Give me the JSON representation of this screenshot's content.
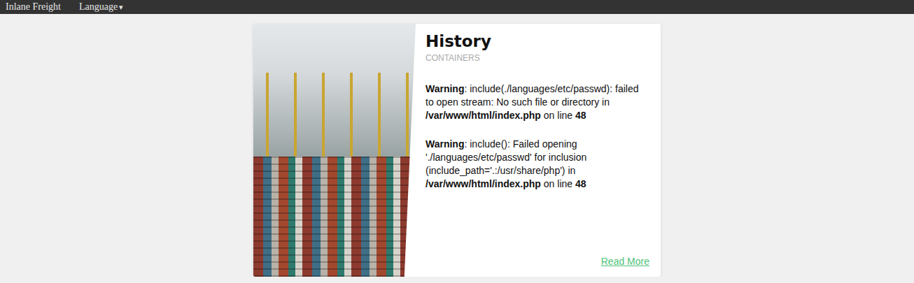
{
  "navbar": {
    "brand": "Inlane Freight",
    "menu": {
      "label": "Language",
      "caret": "▾"
    }
  },
  "card": {
    "title": "History",
    "subtitle": "CONTAINERS",
    "warnings": [
      {
        "label": "Warning",
        "message": ": include(./languages/etc/passwd): failed to open stream: No such file or directory in ",
        "file": "/var/www/html/index.php",
        "mid": " on line ",
        "line": "48"
      },
      {
        "label": "Warning",
        "message": ": include(): Failed opening './languages/etc/passwd' for inclusion (include_path='.:/usr/share/php') in ",
        "file": "/var/www/html/index.php",
        "mid": " on line ",
        "line": "48"
      }
    ],
    "link": "Read More"
  }
}
